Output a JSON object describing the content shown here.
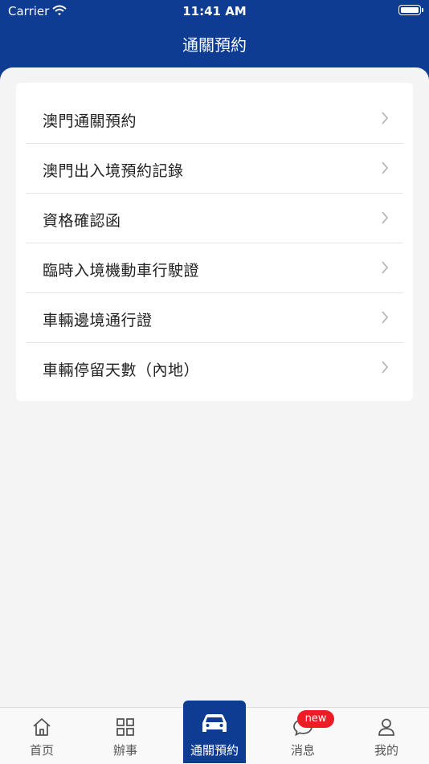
{
  "status_bar": {
    "carrier": "Carrier",
    "time": "11:41 AM"
  },
  "header": {
    "title": "通關預約"
  },
  "menu": {
    "items": [
      {
        "label": "澳門通關預約"
      },
      {
        "label": "澳門出入境預約記錄"
      },
      {
        "label": "資格確認函"
      },
      {
        "label": "臨時入境機動車行駛證"
      },
      {
        "label": "車輛邊境通行證"
      },
      {
        "label": "車輛停留天數（內地）"
      }
    ]
  },
  "tabbar": {
    "tabs": [
      {
        "label": "首页",
        "icon": "home-icon"
      },
      {
        "label": "辦事",
        "icon": "grid-icon"
      },
      {
        "label": "通關預約",
        "icon": "car-icon",
        "active": true
      },
      {
        "label": "消息",
        "icon": "chat-icon",
        "badge": "new"
      },
      {
        "label": "我的",
        "icon": "user-icon"
      }
    ]
  },
  "colors": {
    "brand": "#0d3c92",
    "badge": "#ee1c25",
    "background": "#f4f4f4"
  }
}
